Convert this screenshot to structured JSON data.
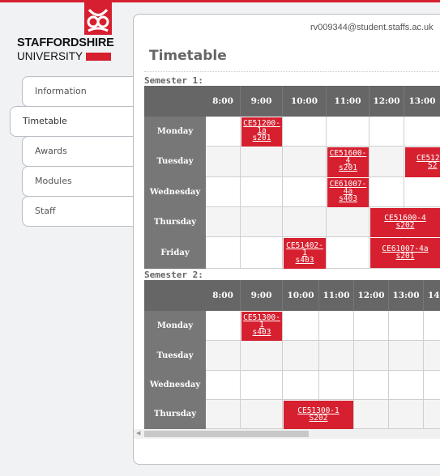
{
  "brand": {
    "line1": "STAFFORDSHIRE",
    "line2": "UNIVERSITY",
    "accent_color": "#d6202f",
    "logo_icon": "stafford-knot-icon"
  },
  "nav": {
    "items": [
      {
        "label": "Information",
        "active": false
      },
      {
        "label": "Timetable",
        "active": true
      },
      {
        "label": "Awards",
        "active": false
      },
      {
        "label": "Modules",
        "active": false
      },
      {
        "label": "Staff",
        "active": false
      }
    ]
  },
  "header": {
    "user_email": "rv009344@student.staffs.ac.uk",
    "title": "Timetable"
  },
  "semester1": {
    "label": "Semester 1:",
    "times": [
      "8:00",
      "9:00",
      "10:00",
      "11:00",
      "12:00",
      "13:00"
    ],
    "days": [
      "Monday",
      "Tuesday",
      "Wednesday",
      "Thursday",
      "Friday"
    ],
    "sessions": [
      {
        "text": "CE51200-1a s201",
        "lines": [
          "CE51200-",
          "1a",
          "s201"
        ]
      },
      {
        "text": "CE51600-4 s201",
        "lines": [
          "CE51600-",
          "4",
          "s201"
        ]
      },
      {
        "text": "CE512 S2",
        "lines": [
          "CE512",
          "S2"
        ]
      },
      {
        "text": "CE61007-4a s403",
        "lines": [
          "CE61007-",
          "4a",
          "s403"
        ]
      },
      {
        "text": "CE51600-4 s202",
        "lines": [
          "CE51600-4",
          "s202"
        ]
      },
      {
        "text": "CE51402-1 s403",
        "lines": [
          "CE51402-",
          "1",
          "s403"
        ]
      },
      {
        "text": "CE61007-4a s201",
        "lines": [
          "CE61007-4a",
          "s201"
        ]
      }
    ]
  },
  "semester2": {
    "label": "Semester 2:",
    "times": [
      "8:00",
      "9:00",
      "10:00",
      "11:00",
      "12:00",
      "13:00",
      "14"
    ],
    "days": [
      "Monday",
      "Tuesday",
      "Wednesday",
      "Thursday"
    ],
    "sessions": [
      {
        "text": "CE51300-1 s403",
        "lines": [
          "CE51300-",
          "1",
          "s403"
        ]
      },
      {
        "text": "CE51300-1 S202",
        "lines": [
          "CE51300-1",
          "S202"
        ]
      }
    ]
  }
}
